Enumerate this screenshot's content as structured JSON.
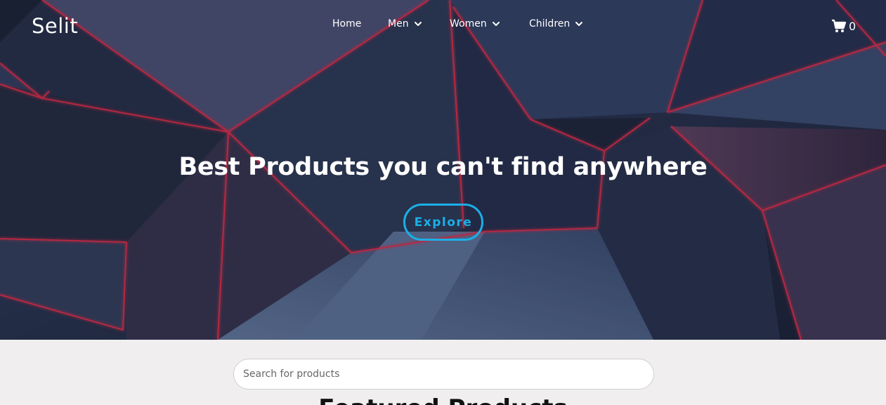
{
  "brand": {
    "name": "Selit"
  },
  "nav": {
    "items": [
      {
        "label": "Home",
        "has_dropdown": false
      },
      {
        "label": "Men",
        "has_dropdown": true
      },
      {
        "label": "Women",
        "has_dropdown": true
      },
      {
        "label": "Children",
        "has_dropdown": true
      }
    ],
    "cart": {
      "icon": "cart-icon",
      "count": "0"
    }
  },
  "hero": {
    "headline": "Best Products you can't find anywhere",
    "cta_label": "Explore",
    "accent_color": "#1ab0e8"
  },
  "search": {
    "placeholder": "Search for products",
    "value": ""
  },
  "section": {
    "title": "Featured Products"
  }
}
